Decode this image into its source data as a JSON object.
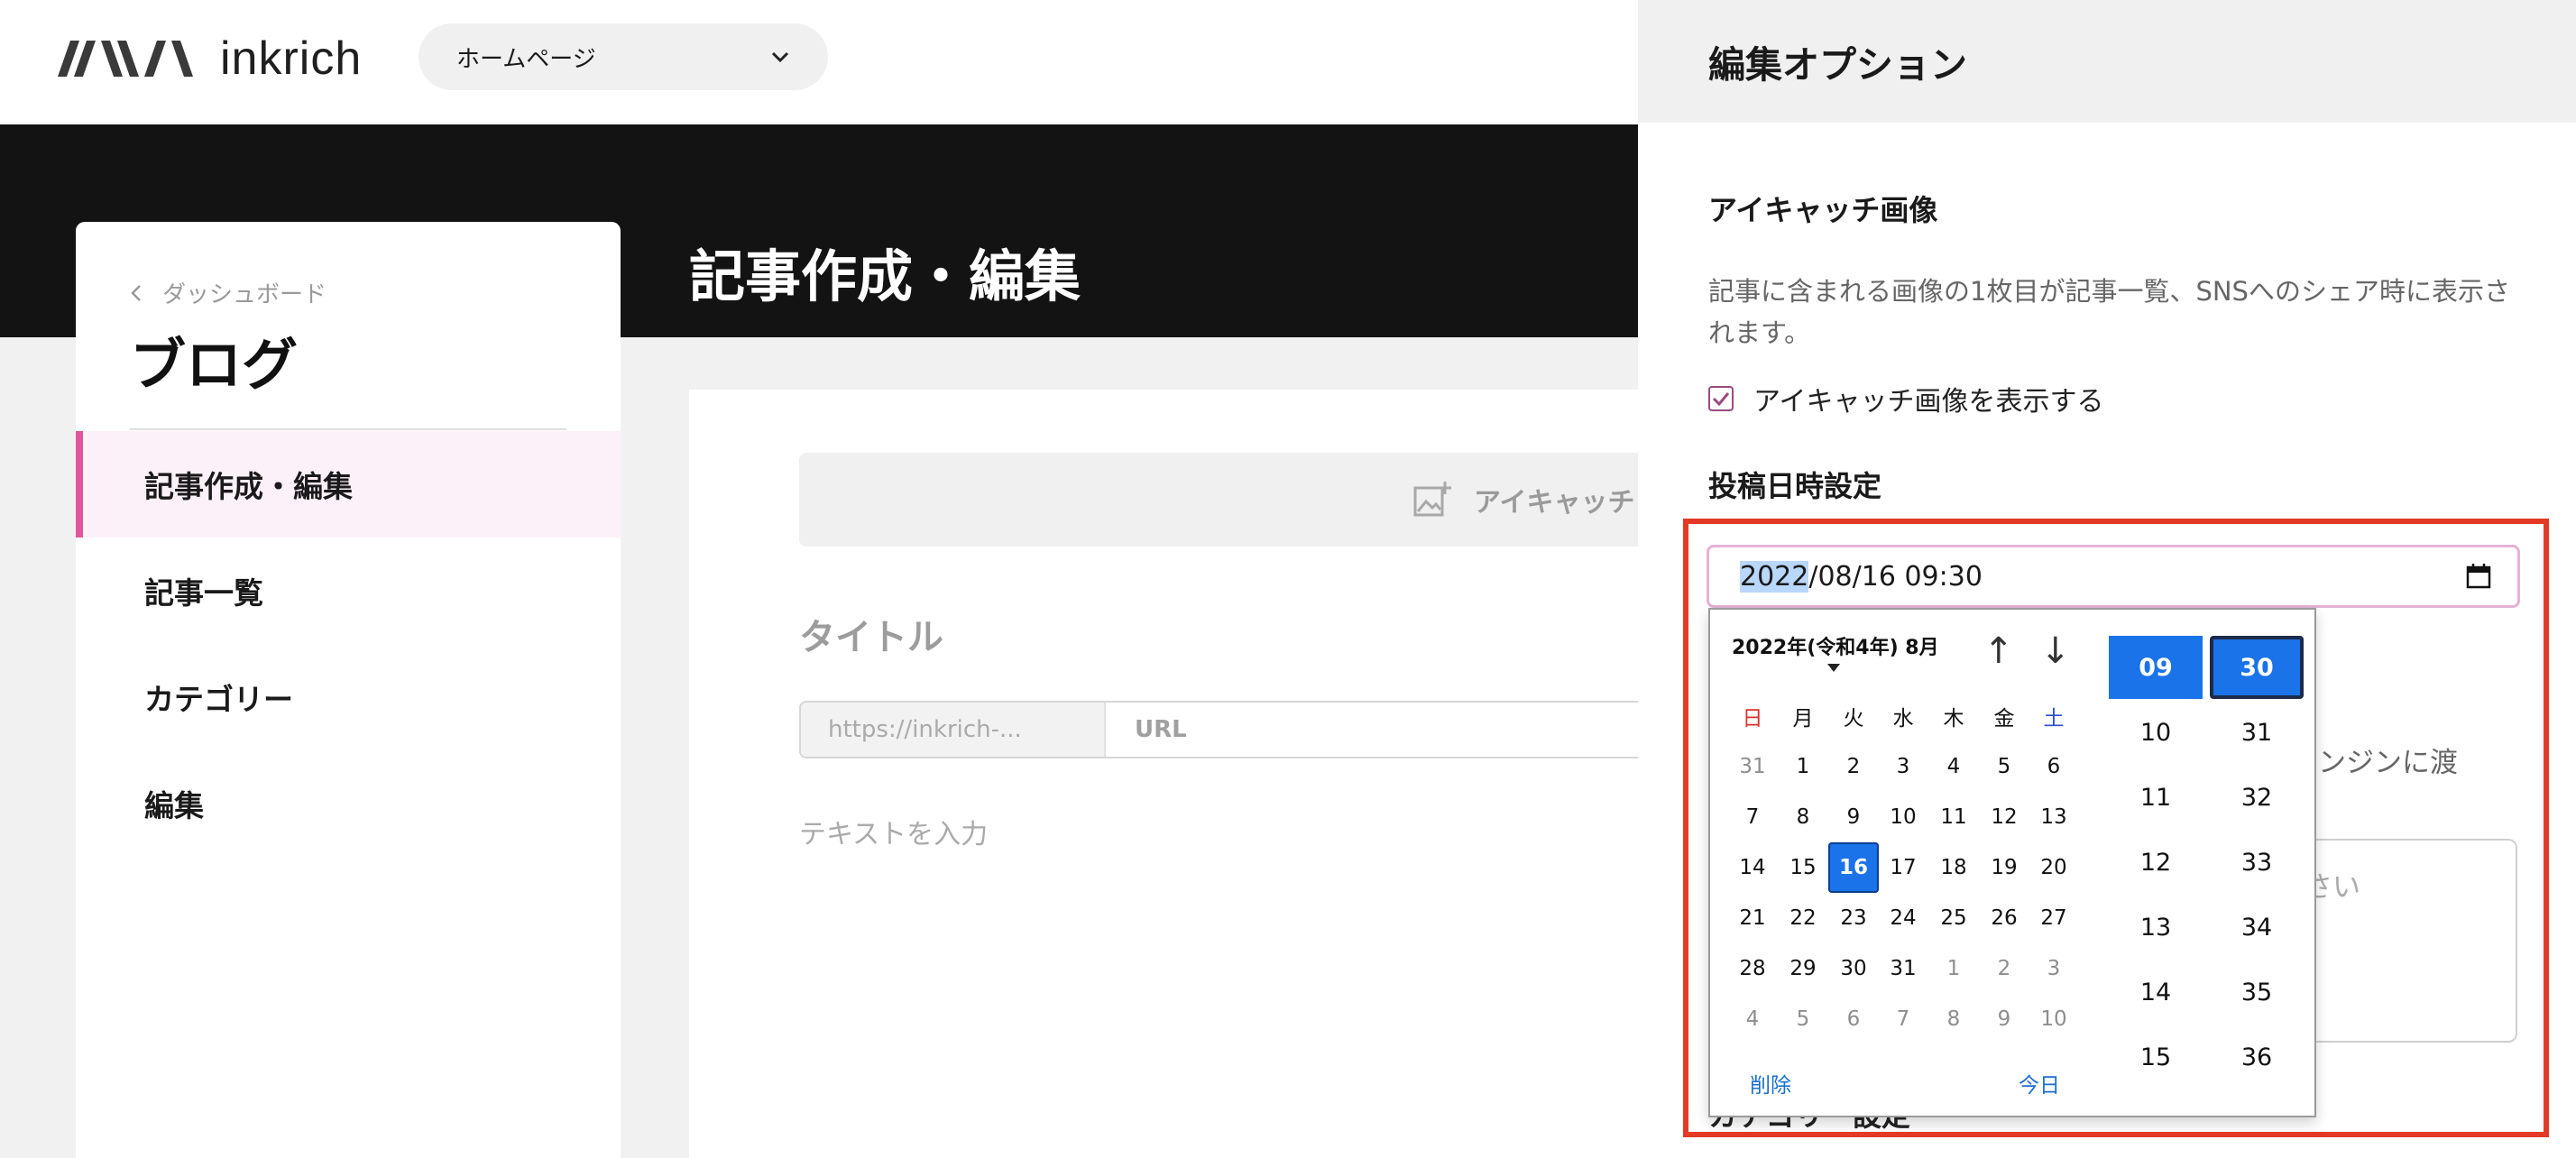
{
  "header": {
    "logo_text": "inkrich",
    "site_select": "ホームページ"
  },
  "sidebar": {
    "back_label": "ダッシュボード",
    "title": "ブログ",
    "items": [
      {
        "label": "記事作成・編集",
        "active": true
      },
      {
        "label": "記事一覧"
      },
      {
        "label": "カテゴリー"
      },
      {
        "label": "編集"
      }
    ]
  },
  "main": {
    "page_title": "記事作成・編集",
    "eyecatch_button": "アイキャッチ",
    "title_placeholder": "タイトル",
    "url_prefix": "https://inkrich-...",
    "url_label": "URL",
    "text_placeholder": "テキストを入力"
  },
  "panel": {
    "title": "編集オプション",
    "eyecatch_heading": "アイキャッチ画像",
    "eyecatch_desc": "記事に含まれる画像の1枚目が記事一覧、SNSへのシェア時に表示されます。",
    "eyecatch_checkbox": "アイキャッチ画像を表示する",
    "eyecatch_checked": true,
    "datetime_heading": "投稿日時設定",
    "datetime_year": "2022",
    "datetime_rest": "/08/16 09:30",
    "behind_text_1": "索エンジンに渡",
    "behind_text_2": "ださい",
    "behind_heading": "カテゴリー設定"
  },
  "picker": {
    "month_label": "2022年(令和4年) 8月",
    "weekdays": [
      "日",
      "月",
      "火",
      "水",
      "木",
      "金",
      "土"
    ],
    "weeks": [
      [
        "31",
        "1",
        "2",
        "3",
        "4",
        "5",
        "6"
      ],
      [
        "7",
        "8",
        "9",
        "10",
        "11",
        "12",
        "13"
      ],
      [
        "14",
        "15",
        "16",
        "17",
        "18",
        "19",
        "20"
      ],
      [
        "21",
        "22",
        "23",
        "24",
        "25",
        "26",
        "27"
      ],
      [
        "28",
        "29",
        "30",
        "31",
        "1",
        "2",
        "3"
      ],
      [
        "4",
        "5",
        "6",
        "7",
        "8",
        "9",
        "10"
      ]
    ],
    "selected_day": "16",
    "delete_label": "削除",
    "today_label": "今日",
    "hours": [
      "09",
      "10",
      "11",
      "12",
      "13",
      "14",
      "15"
    ],
    "minutes": [
      "30",
      "31",
      "32",
      "33",
      "34",
      "35",
      "36"
    ],
    "selected_hour": "09",
    "selected_minute": "30"
  },
  "colors": {
    "accent": "#e0569d",
    "highlight": "#e33a26",
    "picker_blue": "#1a73e8"
  }
}
